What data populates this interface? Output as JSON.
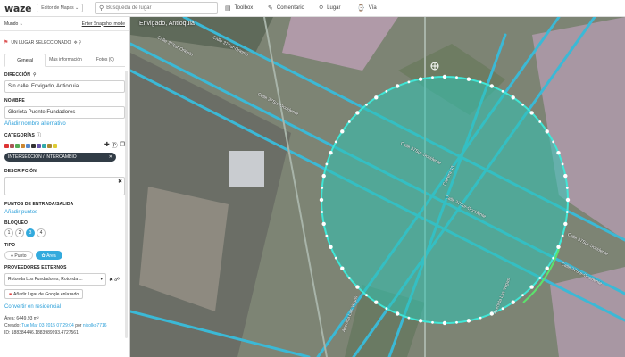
{
  "topbar": {
    "logo": "waze",
    "editor_dropdown": "Editor de Mapas ⌄",
    "search_placeholder": "Búsqueda de lugar",
    "toolbox": "Toolbox",
    "comments": "Comentario",
    "place": "Lugar",
    "road": "Vía"
  },
  "subbar": {
    "left": "Mundo ⌄",
    "right": "Enter Snapshot mode"
  },
  "selection": {
    "label": "UN LUGAR SELECCIONADO"
  },
  "tabs": [
    {
      "label": "General",
      "active": true
    },
    {
      "label": "Más información",
      "active": false
    },
    {
      "label": "Fotos (0)",
      "active": false
    }
  ],
  "form": {
    "address_label": "DIRECCIÓN",
    "address_value": "Sin calle, Envigado, Antioquia",
    "name_label": "NOMBRE",
    "name_value": "Glorieta Puente Fundadores",
    "alt_name_link": "Añadir nombre alternativo",
    "categories_label": "CATEGORÍAS",
    "category_pill": "INTERSECCIÓN / INTERCAMBIO",
    "description_label": "DESCRIPCIÓN",
    "entry_label": "PUNTOS DE ENTRADA/SALIDA",
    "add_points_link": "Añadir puntos",
    "lock_label": "BLOQUEO",
    "lock_levels": [
      "1",
      "2",
      "3",
      "4"
    ],
    "lock_active": "3",
    "type_label": "TIPO",
    "type_point": "Punto",
    "type_area": "Área",
    "providers_label": "PROVEEDORES EXTERNOS",
    "provider_value": "Rotonda Los Fundadores, Rotonda ...",
    "google_button": "Añadir lugar de Google enlazado",
    "convert_link": "Convertir en residencial",
    "area_text": "Área: 6449.93 m²",
    "created_prefix": "Creado: ",
    "created_date": "Tue Mar 03 2015 07:29:04",
    "created_by_prefix": " por ",
    "created_user": "nikolko7716",
    "id_text": "ID: 188384446.1883989993.4727561"
  },
  "map": {
    "place_label": "Envigado, Antioquia",
    "road_labels": [
      "Calle 37Sur-Oriente",
      "Calle 37Sur-Oriente",
      "Calle 37Sur-Occidente",
      "Calle 37Sur-Occidente",
      "Calle 37Sur-Occidente",
      "Carrera 43",
      "Avenida Las Vegas",
      "Calle 37Sur-Occidente",
      "Calle 37Sur-Occidente",
      "Avenida Las Vegas"
    ]
  },
  "colors": {
    "accent": "#33aadd",
    "road": "#3bb9d6",
    "area_fill": "#2fc4b5",
    "vertex": "#ffffff"
  }
}
